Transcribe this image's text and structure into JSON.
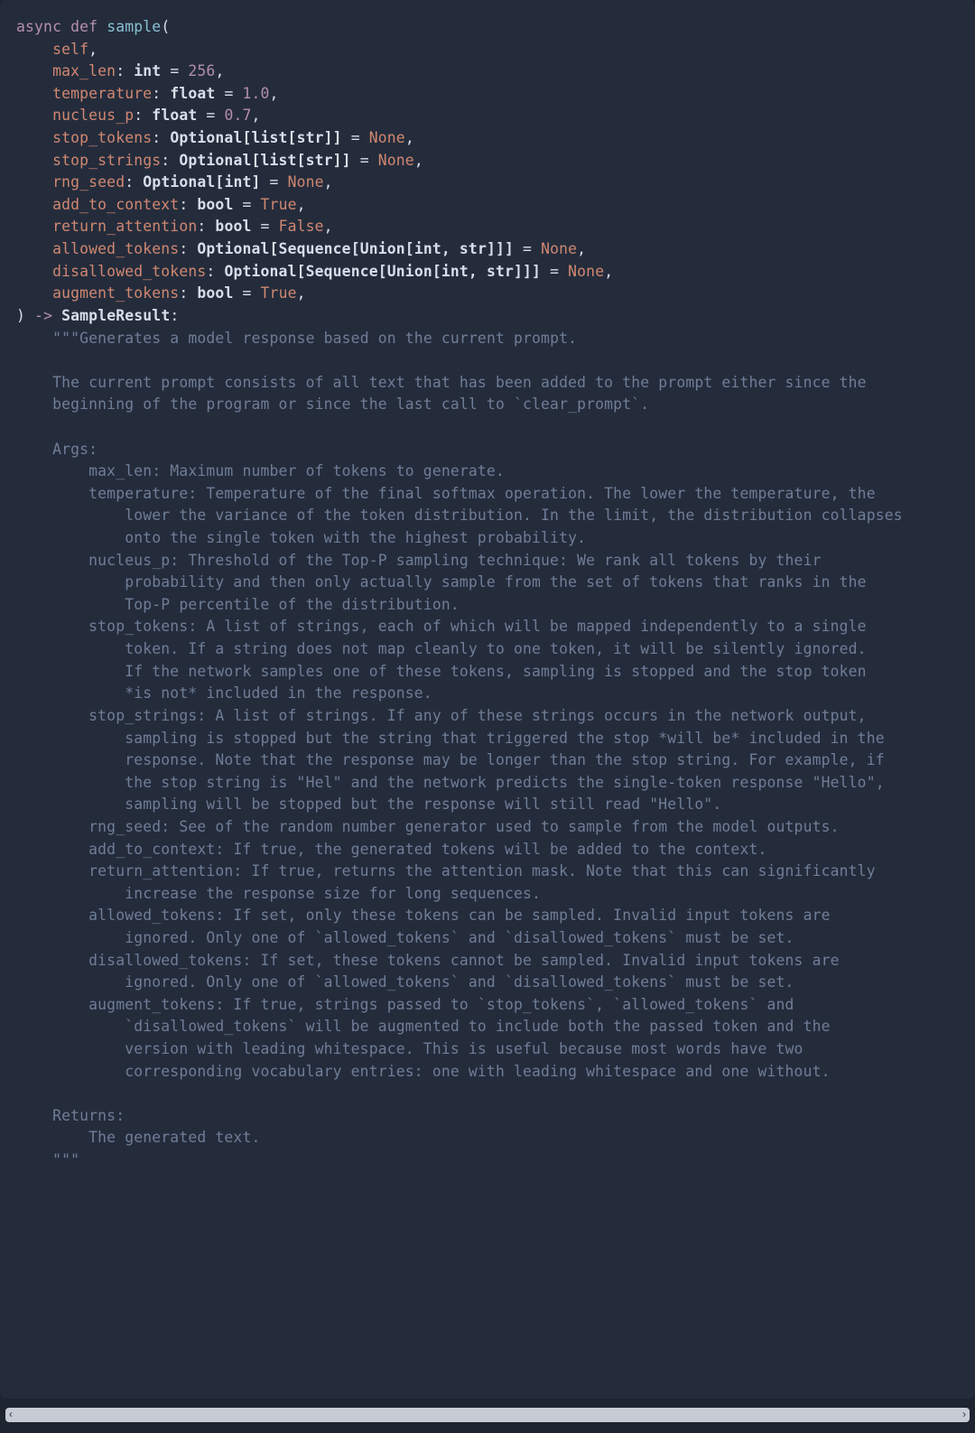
{
  "signature": {
    "async": "async",
    "def": "def",
    "name": "sample",
    "open": "(",
    "self": "self",
    "params": [
      {
        "name": "max_len",
        "type": "int",
        "default_kind": "num",
        "default": "256"
      },
      {
        "name": "temperature",
        "type": "float",
        "default_kind": "num",
        "default": "1.0"
      },
      {
        "name": "nucleus_p",
        "type": "float",
        "default_kind": "num",
        "default": "0.7"
      },
      {
        "name": "stop_tokens",
        "type": "Optional[list[str]]",
        "default_kind": "const",
        "default": "None"
      },
      {
        "name": "stop_strings",
        "type": "Optional[list[str]]",
        "default_kind": "const",
        "default": "None"
      },
      {
        "name": "rng_seed",
        "type": "Optional[int]",
        "default_kind": "const",
        "default": "None"
      },
      {
        "name": "add_to_context",
        "type": "bool",
        "default_kind": "const",
        "default": "True"
      },
      {
        "name": "return_attention",
        "type": "bool",
        "default_kind": "const",
        "default": "False"
      },
      {
        "name": "allowed_tokens",
        "type": "Optional[Sequence[Union[int, str]]]",
        "default_kind": "const",
        "default": "None"
      },
      {
        "name": "disallowed_tokens",
        "type": "Optional[Sequence[Union[int, str]]]",
        "default_kind": "const",
        "default": "None"
      },
      {
        "name": "augment_tokens",
        "type": "bool",
        "default_kind": "const",
        "default": "True"
      }
    ],
    "close": ")",
    "arrow": "->",
    "ret": "SampleResult",
    "colon": ":"
  },
  "doc": {
    "triple_open": "\"\"\"",
    "summary": "Generates a model response based on the current prompt.",
    "intro1": "    The current prompt consists of all text that has been added to the prompt either since the",
    "intro2": "    beginning of the program or since the last call to `clear_prompt`.",
    "args_hdr": "    Args:",
    "args": [
      "        max_len: Maximum number of tokens to generate.",
      "        temperature: Temperature of the final softmax operation. The lower the temperature, the",
      "            lower the variance of the token distribution. In the limit, the distribution collapses",
      "            onto the single token with the highest probability.",
      "        nucleus_p: Threshold of the Top-P sampling technique: We rank all tokens by their",
      "            probability and then only actually sample from the set of tokens that ranks in the",
      "            Top-P percentile of the distribution.",
      "        stop_tokens: A list of strings, each of which will be mapped independently to a single",
      "            token. If a string does not map cleanly to one token, it will be silently ignored.",
      "            If the network samples one of these tokens, sampling is stopped and the stop token",
      "            *is not* included in the response.",
      "        stop_strings: A list of strings. If any of these strings occurs in the network output,",
      "            sampling is stopped but the string that triggered the stop *will be* included in the",
      "            response. Note that the response may be longer than the stop string. For example, if",
      "            the stop string is \"Hel\" and the network predicts the single-token response \"Hello\",",
      "            sampling will be stopped but the response will still read \"Hello\".",
      "        rng_seed: See of the random number generator used to sample from the model outputs.",
      "        add_to_context: If true, the generated tokens will be added to the context.",
      "        return_attention: If true, returns the attention mask. Note that this can significantly",
      "            increase the response size for long sequences.",
      "        allowed_tokens: If set, only these tokens can be sampled. Invalid input tokens are",
      "            ignored. Only one of `allowed_tokens` and `disallowed_tokens` must be set.",
      "        disallowed_tokens: If set, these tokens cannot be sampled. Invalid input tokens are",
      "            ignored. Only one of `allowed_tokens` and `disallowed_tokens` must be set.",
      "        augment_tokens: If true, strings passed to `stop_tokens`, `allowed_tokens` and",
      "            `disallowed_tokens` will be augmented to include both the passed token and the",
      "            version with leading whitespace. This is useful because most words have two",
      "            corresponding vocabulary entries: one with leading whitespace and one without."
    ],
    "returns_hdr": "    Returns:",
    "returns_body": "        The generated text.",
    "triple_close": "    \"\"\""
  },
  "scroll": {
    "left": "‹",
    "right": "›"
  }
}
